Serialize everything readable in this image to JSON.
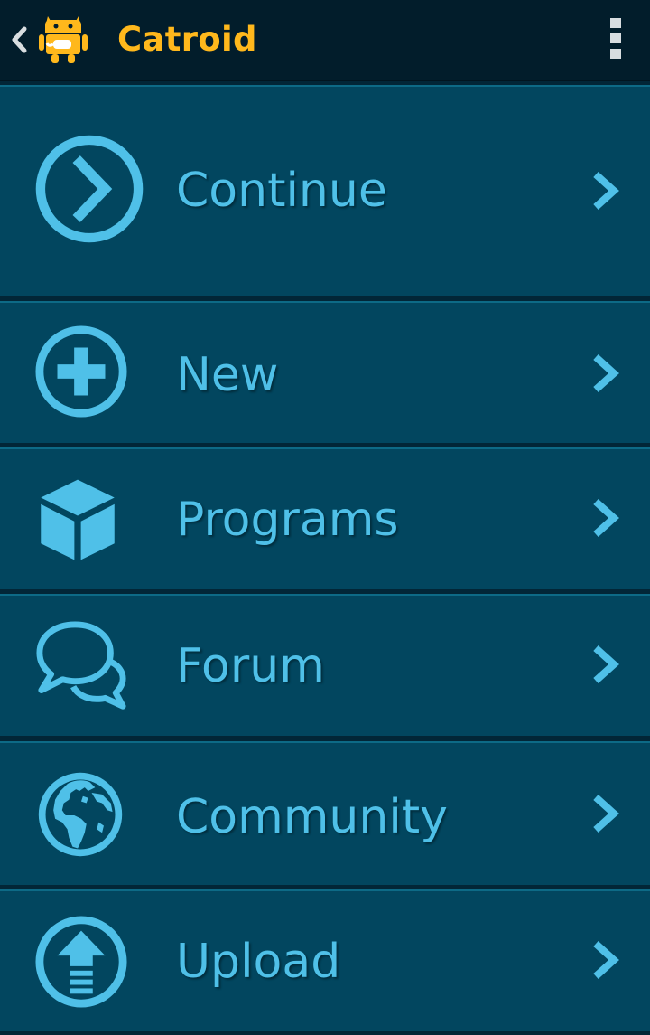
{
  "action_bar": {
    "title": "Catroid",
    "back_icon": "chevron-left-icon",
    "logo_icon": "catroid-cat-logo",
    "overflow_icon": "overflow-menu-icon"
  },
  "colors": {
    "title": "#ffb81c",
    "accent": "#4fc0e8",
    "item_bg": "#02465f",
    "bar_bg": "#021d2b"
  },
  "menu": {
    "items": [
      {
        "label": "Continue",
        "icon": "continue-arrow-circle-icon"
      },
      {
        "label": "New",
        "icon": "plus-circle-icon"
      },
      {
        "label": "Programs",
        "icon": "cube-icon"
      },
      {
        "label": "Forum",
        "icon": "speech-bubbles-icon"
      },
      {
        "label": "Community",
        "icon": "globe-icon"
      },
      {
        "label": "Upload",
        "icon": "upload-circle-icon"
      }
    ]
  }
}
